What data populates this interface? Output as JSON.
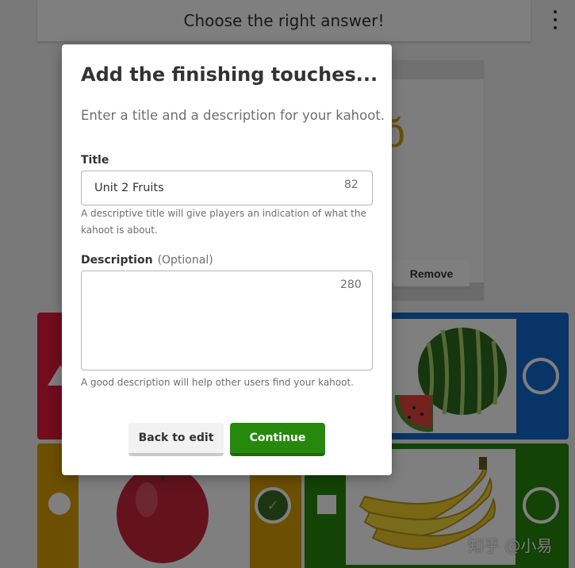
{
  "question": {
    "text": "Choose the right answer!"
  },
  "media": {
    "character": "ŏ",
    "remove_label": "Remove"
  },
  "modal": {
    "title": "Add the finishing touches...",
    "subtitle": "Enter a title and a description for your kahoot.",
    "title_field": {
      "label": "Title",
      "value": "Unit 2 Fruits",
      "char_count": "82",
      "help": "A descriptive title will give players an indication of what the kahoot is about."
    },
    "description_field": {
      "label": "Description",
      "optional": "(Optional)",
      "value": "",
      "char_count": "280",
      "help": "A good description will help other users find your kahoot."
    },
    "back_label": "Back to edit",
    "continue_label": "Continue"
  },
  "answers": [
    {
      "color": "red",
      "shape": "triangle",
      "image": ""
    },
    {
      "color": "blue",
      "shape": "",
      "image": "watermelon"
    },
    {
      "color": "yellow",
      "shape": "circle",
      "image": "apple",
      "correct": true
    },
    {
      "color": "green",
      "shape": "square",
      "image": "banana"
    }
  ],
  "colors": {
    "red": "#e21b3c",
    "blue": "#1368ce",
    "yellow": "#d89e00",
    "green": "#26890c",
    "continue": "#26890c"
  },
  "watermark": "知乎 @小易"
}
